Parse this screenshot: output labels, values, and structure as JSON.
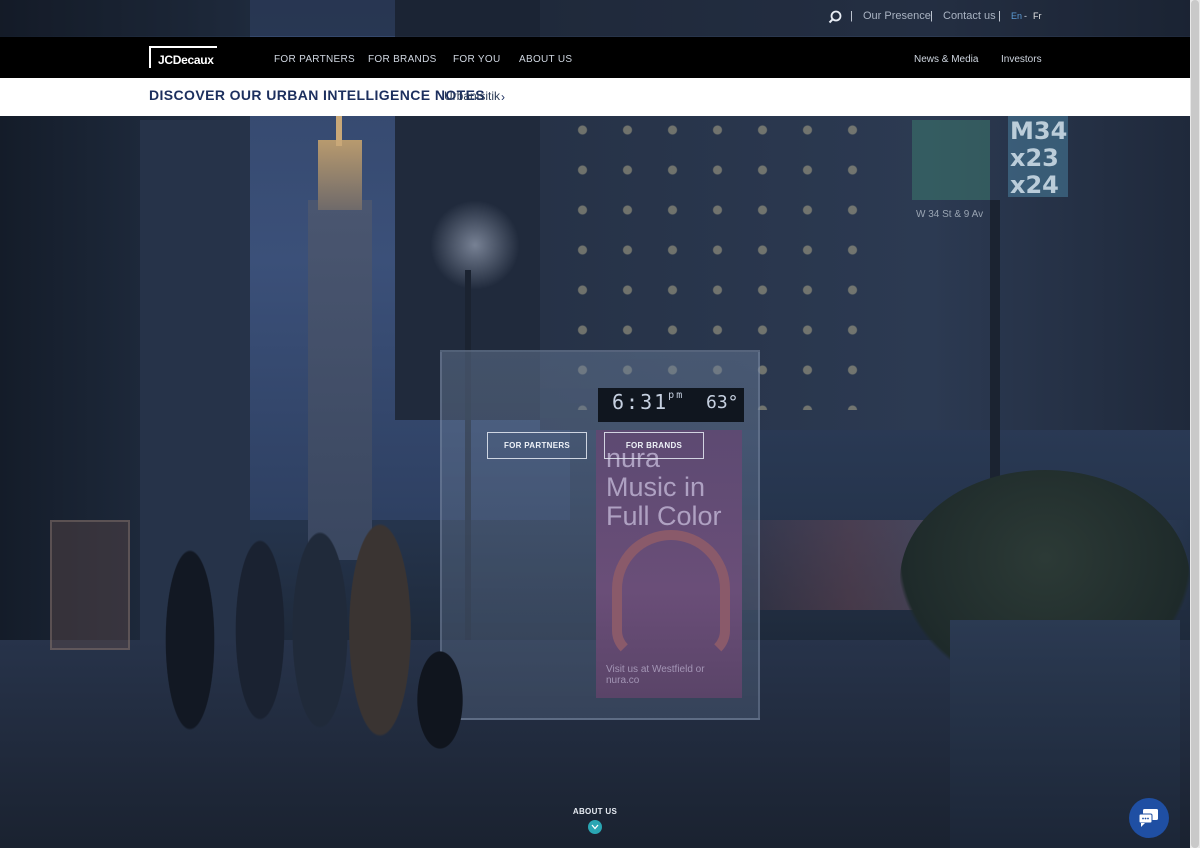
{
  "utility": {
    "search_icon": "search-icon",
    "links": [
      {
        "label": "Our Presence"
      },
      {
        "label": "Contact us"
      }
    ],
    "languages": [
      {
        "label": "En",
        "active": true,
        "color": "#5b9bd5"
      },
      {
        "label": "Fr",
        "active": false,
        "color": "#e6e6e6"
      }
    ],
    "lang_separator": "-",
    "separator": "|"
  },
  "navbar": {
    "logo": "JCDecaux",
    "items": [
      {
        "label": "FOR PARTNERS"
      },
      {
        "label": "FOR BRANDS"
      },
      {
        "label": "FOR YOU"
      },
      {
        "label": "ABOUT US"
      }
    ],
    "right_items": [
      {
        "label": "News & Media"
      },
      {
        "label": "Investors"
      }
    ]
  },
  "promo": {
    "title": "DISCOVER OUR URBAN INTELLIGENCE NOTES",
    "link": "Urbanisitik",
    "chevron": "›",
    "title_color": "#1c2f5e"
  },
  "hero": {
    "clock": "6:31",
    "clock_suffix": "pm",
    "temperature": "63°",
    "poster_headline": "nura Music in Full Color",
    "poster_footer": "Visit us at Westfield or nura.co",
    "bus_sign": "M34 x23 x24",
    "street_sign": "W 34 St & 9 Av",
    "cta_buttons": [
      {
        "label": "FOR PARTNERS"
      },
      {
        "label": "FOR BRANDS"
      }
    ]
  },
  "scroll": {
    "label": "ABOUT US",
    "arrow_icon": "chevron-down-icon",
    "accent": "#2aa6b3"
  },
  "chat": {
    "icon": "chat-icon",
    "color": "#1f4fa3"
  }
}
